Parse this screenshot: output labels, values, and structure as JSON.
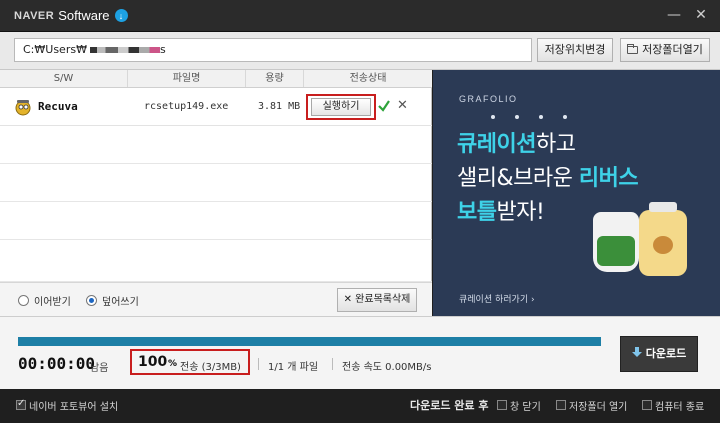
{
  "window": {
    "brand_naver": "NAVER",
    "brand_software": "Software",
    "minimize_symbol": "—",
    "close_symbol": "✕"
  },
  "path_bar": {
    "path_prefix": "C:₩Users₩",
    "path_suffix": "s",
    "change_location_label": "저장위치변경",
    "open_folder_label": "저장폴더열기"
  },
  "list": {
    "columns": [
      "S/W",
      "파일명",
      "용량",
      "전송상태"
    ],
    "rows": [
      {
        "app_name": "Recuva",
        "file_name": "rcsetup149.exe",
        "size": "3.81 MB",
        "action_label": "실행하기"
      }
    ],
    "footer": {
      "mode_resume": "이어받기",
      "mode_overwrite": "덮어쓰기",
      "clear_done_label": "완료목록삭제"
    }
  },
  "ad": {
    "brand": "GRAFOLIO",
    "line1_accent": "큐레이션",
    "line1_rest": "하고",
    "line2_rest": "샐리&브라운 ",
    "line2_accent": "리버스",
    "line3_accent": "보틀",
    "line3_rest": "받자!",
    "cta": "큐레이션 하러가기 ›"
  },
  "progress": {
    "percent_complete": 100,
    "time_remaining": "00:00:00",
    "remaining_label": "남음",
    "percent_value": "100",
    "percent_unit": "%",
    "transfer_detail": "전송 (3/3MB)",
    "files_count": "1/1 개 파일",
    "speed": "전송 속도 0.00MB/s",
    "download_label": "다운로드"
  },
  "bottom": {
    "install_photoviewer": "네이버 포토뷰어 설치",
    "after_download_label": "다운로드 완료 후",
    "close_window": "창 닫기",
    "open_folder": "저장폴더 열기",
    "shutdown": "컴퓨터 종료"
  },
  "colors": {
    "accent_blue": "#1d7fa6",
    "highlight_red": "#c81e1e",
    "ad_bg": "#2b3a55",
    "ad_accent": "#3ed2e8"
  }
}
